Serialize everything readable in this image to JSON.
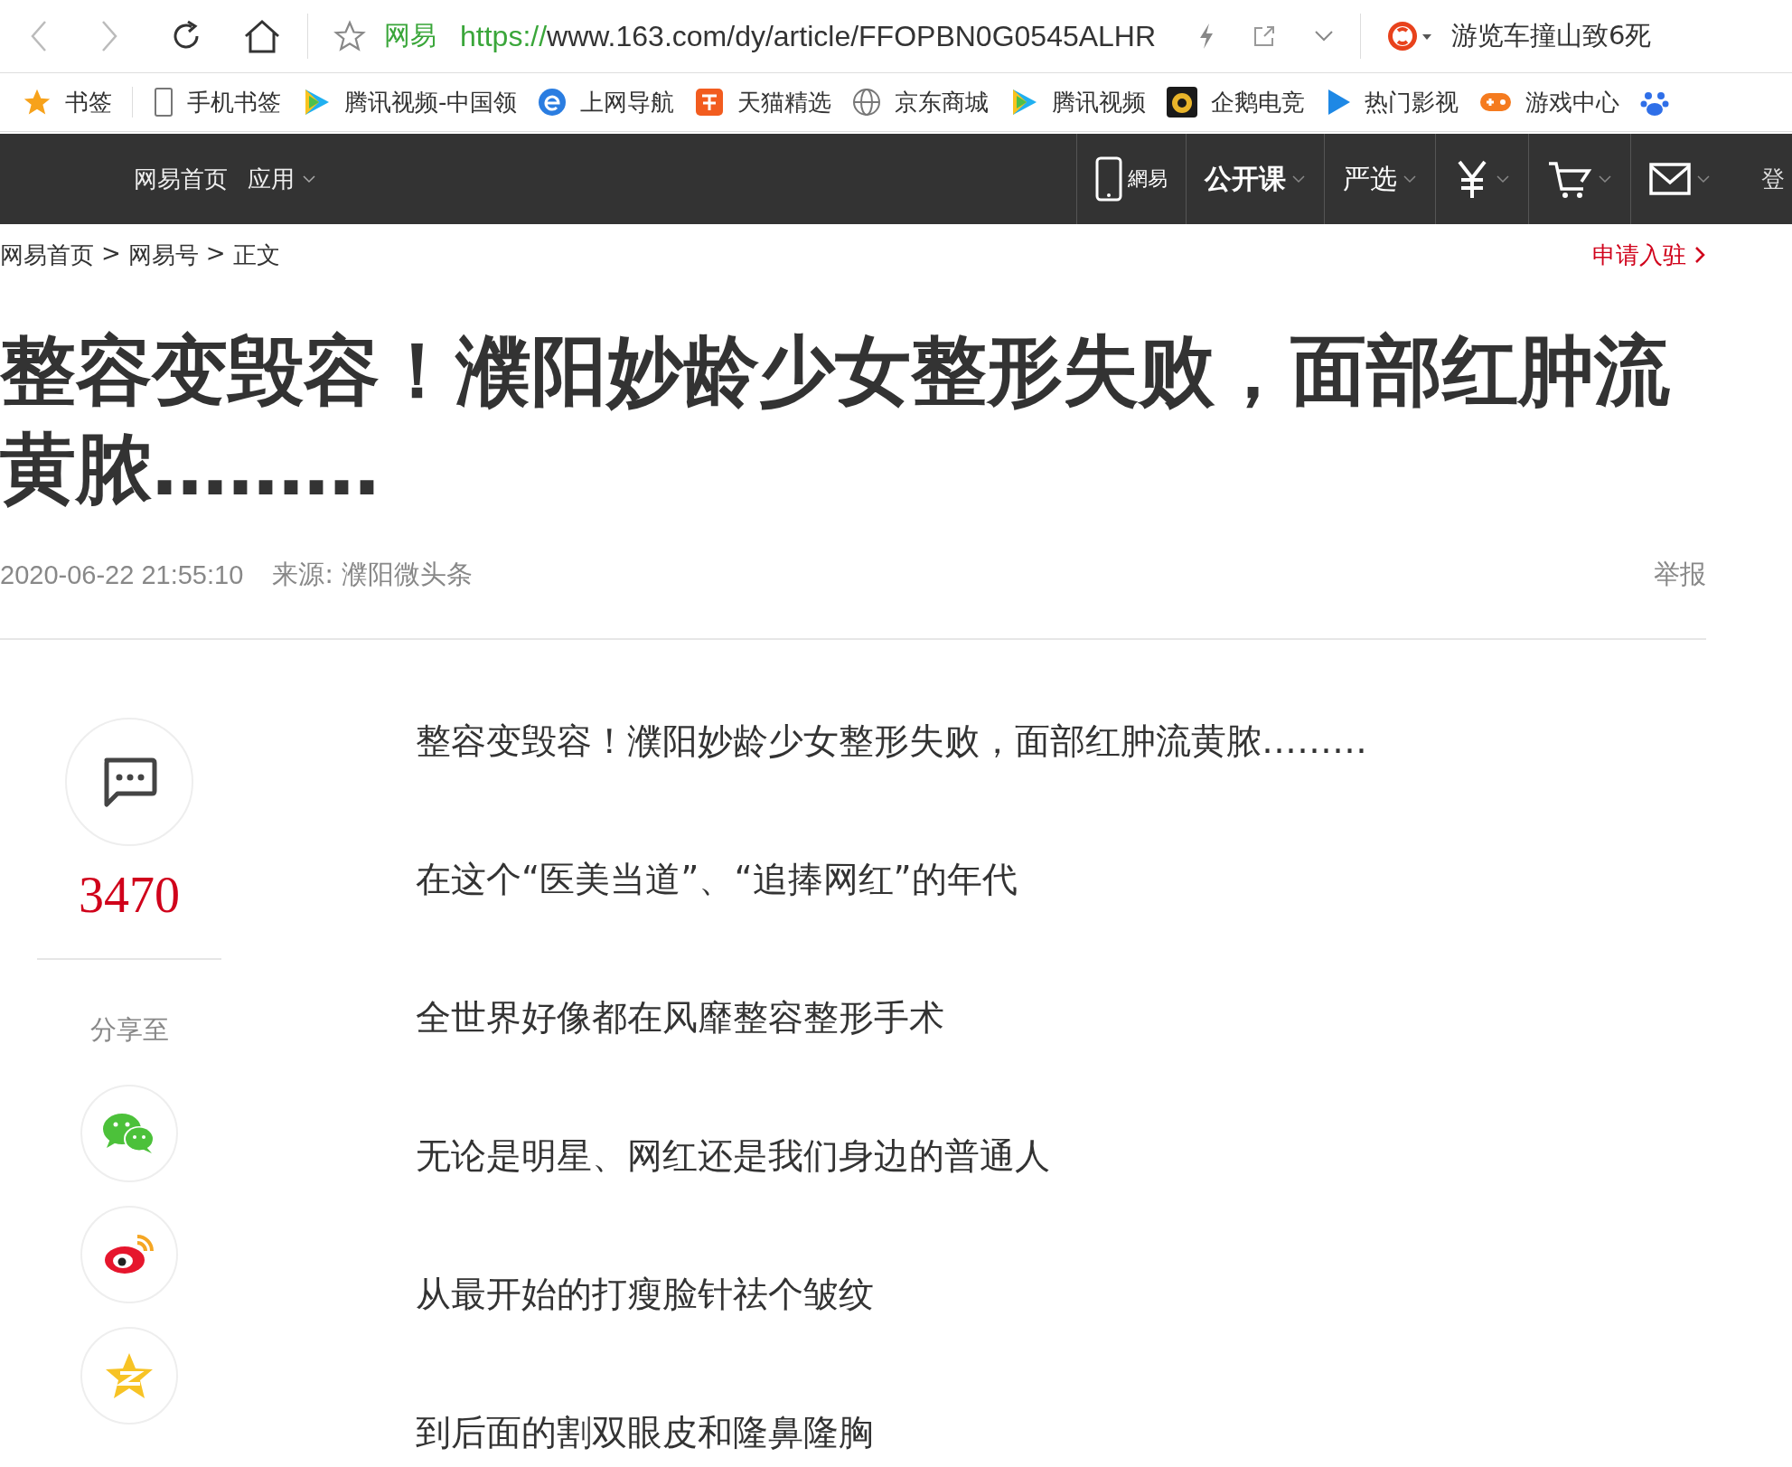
{
  "browser": {
    "site_label": "网易",
    "url_scheme": "https://",
    "url_rest": "www.163.com/dy/article/FFOPBN0G0545ALHR",
    "search_text": "游览车撞山致6死"
  },
  "bookmarks": [
    {
      "label": "书签",
      "kind": "star"
    },
    {
      "label": "手机书签",
      "kind": "phone"
    },
    {
      "label": "腾讯视频-中国领",
      "kind": "video"
    },
    {
      "label": "上网导航",
      "kind": "ie"
    },
    {
      "label": "天猫精选",
      "kind": "tmall"
    },
    {
      "label": "京东商城",
      "kind": "globe"
    },
    {
      "label": "腾讯视频",
      "kind": "video"
    },
    {
      "label": "企鹅电竞",
      "kind": "esports"
    },
    {
      "label": "热门影视",
      "kind": "play"
    },
    {
      "label": "游戏中心",
      "kind": "game"
    }
  ],
  "nav": {
    "left": [
      {
        "label": "网易首页",
        "dropdown": false
      },
      {
        "label": "应用",
        "dropdown": true
      }
    ],
    "right": [
      {
        "kind": "phone",
        "label": "網易"
      },
      {
        "kind": "text",
        "label": "公开课",
        "bold": true
      },
      {
        "kind": "text",
        "label": "严选",
        "bold": false
      },
      {
        "kind": "yuan"
      },
      {
        "kind": "cart"
      },
      {
        "kind": "mail"
      }
    ],
    "login": "登"
  },
  "breadcrumb": [
    "网易首页",
    "网易号",
    "正文"
  ],
  "breadcrumb_separator": ">",
  "apply_link": "申请入驻",
  "article": {
    "title": "整容变毁容！濮阳妙龄少女整形失败，面部红肿流黄脓………",
    "time": "2020-06-22 21:55:10",
    "source": "来源: 濮阳微头条",
    "report": "举报",
    "comment_count": "3470",
    "share_label": "分享至",
    "share": [
      {
        "kind": "wechat"
      },
      {
        "kind": "weibo"
      },
      {
        "kind": "qzone"
      }
    ],
    "paragraphs": [
      "整容变毁容！濮阳妙龄少女整形失败，面部红肿流黄脓………",
      "在这个“医美当道”、“追捧网红”的年代",
      "全世界好像都在风靡整容整形手术",
      "无论是明星、网红还是我们身边的普通人",
      "从最开始的打瘦脸针祛个皱纹",
      "到后面的割双眼皮和隆鼻隆胸"
    ]
  }
}
